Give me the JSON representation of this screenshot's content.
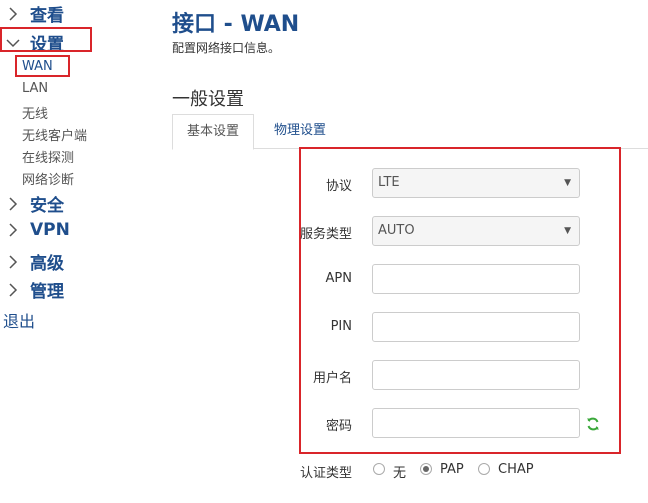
{
  "sidebar": {
    "groups": [
      {
        "label": "查看"
      },
      {
        "label": "设置"
      },
      {
        "label": "安全"
      },
      {
        "label": "VPN"
      },
      {
        "label": "高级"
      },
      {
        "label": "管理"
      }
    ],
    "sub_items": [
      {
        "label": "WAN"
      },
      {
        "label": "LAN"
      },
      {
        "label": "无线"
      },
      {
        "label": "无线客户端"
      },
      {
        "label": "在线探测"
      },
      {
        "label": "网络诊断"
      }
    ],
    "logout": "退出"
  },
  "page": {
    "title": "接口 - WAN",
    "description": "配置网络接口信息。",
    "section_title": "一般设置"
  },
  "tabs": [
    {
      "label": "基本设置",
      "active": true
    },
    {
      "label": "物理设置",
      "active": false
    }
  ],
  "form": {
    "protocol": {
      "label": "协议",
      "value": "LTE"
    },
    "service_type": {
      "label": "服务类型",
      "value": "AUTO"
    },
    "apn": {
      "label": "APN",
      "value": ""
    },
    "pin": {
      "label": "PIN",
      "value": ""
    },
    "username": {
      "label": "用户名",
      "value": ""
    },
    "password": {
      "label": "密码",
      "value": ""
    },
    "auth": {
      "label": "认证类型",
      "options": [
        {
          "label": "无",
          "checked": false
        },
        {
          "label": "PAP",
          "checked": true
        },
        {
          "label": "CHAP",
          "checked": false
        }
      ]
    }
  },
  "colors": {
    "accent": "#1f4e8c",
    "highlight_border": "#d9252a",
    "refresh_icon": "#3aa83a"
  },
  "icons": {
    "nav_chevron": "chevron-right-icon",
    "nav_chevron_open": "chevron-down-icon",
    "refresh": "refresh-icon"
  }
}
